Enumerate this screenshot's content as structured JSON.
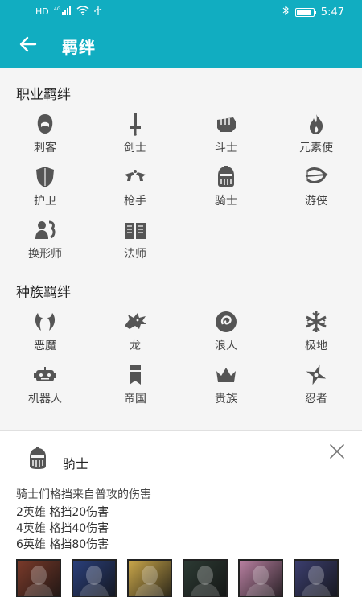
{
  "status_bar": {
    "left_icons": [
      "hd-icon",
      "signal-icon",
      "wifi-icon",
      "usb-icon"
    ],
    "hd_label": "HD",
    "network_label": "4G",
    "battery_level": 0.85,
    "time": "5:47"
  },
  "app_bar": {
    "back_icon": "arrow-left-icon",
    "title": "羁绊"
  },
  "sections": [
    {
      "title": "职业羁绊",
      "items": [
        {
          "label": "刺客",
          "icon": "assassin-icon"
        },
        {
          "label": "剑士",
          "icon": "sword-icon"
        },
        {
          "label": "斗士",
          "icon": "fist-icon"
        },
        {
          "label": "元素使",
          "icon": "flame-icon"
        },
        {
          "label": "护卫",
          "icon": "shield-icon"
        },
        {
          "label": "枪手",
          "icon": "pistols-icon"
        },
        {
          "label": "骑士",
          "icon": "knight-helmet-icon"
        },
        {
          "label": "游侠",
          "icon": "bow-icon"
        },
        {
          "label": "换形师",
          "icon": "shapeshifter-icon"
        },
        {
          "label": "法师",
          "icon": "book-icon"
        }
      ]
    },
    {
      "title": "种族羁绊",
      "items": [
        {
          "label": "恶魔",
          "icon": "demon-horns-icon"
        },
        {
          "label": "龙",
          "icon": "dragon-icon"
        },
        {
          "label": "浪人",
          "icon": "exile-icon"
        },
        {
          "label": "极地",
          "icon": "snowflake-icon"
        },
        {
          "label": "机器人",
          "icon": "robot-icon"
        },
        {
          "label": "帝国",
          "icon": "banner-icon"
        },
        {
          "label": "贵族",
          "icon": "crown-icon"
        },
        {
          "label": "忍者",
          "icon": "shuriken-icon"
        }
      ]
    }
  ],
  "detail_panel": {
    "icon": "knight-helmet-icon",
    "name": "骑士",
    "close_icon": "close-icon",
    "description": "骑士们格挡来自普攻的伤害",
    "tiers": [
      "2英雄 格挡20伤害",
      "4英雄 格挡40伤害",
      "6英雄 格挡80伤害"
    ],
    "heroes": [
      {
        "icon": "hero-portrait-icon",
        "color": "#7a3a2a"
      },
      {
        "icon": "hero-portrait-icon",
        "color": "#2a3f7a"
      },
      {
        "icon": "hero-portrait-icon",
        "color": "#c9a64a"
      },
      {
        "icon": "hero-portrait-icon",
        "color": "#2c3a33"
      },
      {
        "icon": "hero-portrait-icon",
        "color": "#b77fa0"
      },
      {
        "icon": "hero-portrait-icon",
        "color": "#3b3e6e"
      }
    ]
  },
  "colors": {
    "primary": "#11adc1",
    "icon_gray": "#555555",
    "background": "#f5f5f5"
  }
}
